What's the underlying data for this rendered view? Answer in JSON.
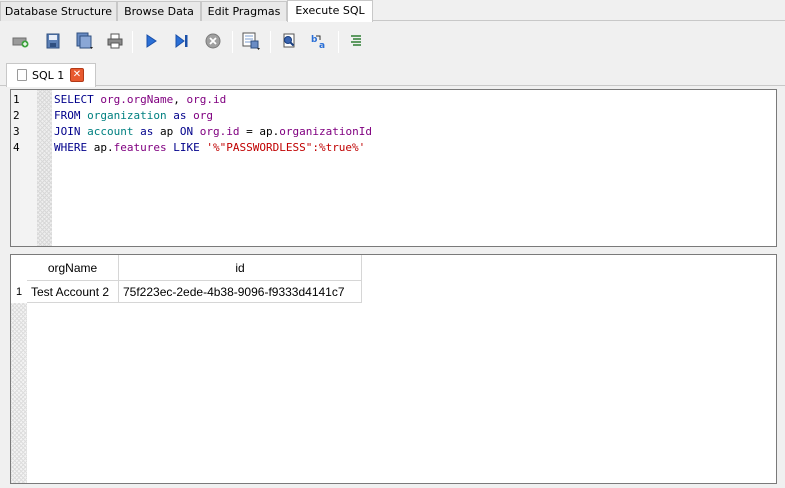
{
  "main_tabs": [
    "Database Structure",
    "Browse Data",
    "Edit Pragmas",
    "Execute SQL"
  ],
  "active_main_tab": "Execute SQL",
  "toolbar": {
    "icons": [
      "open-tab-icon",
      "open-sql-file-icon",
      "save-sql-file-icon",
      "print-icon",
      "execute-all-icon",
      "execute-current-line-icon",
      "stop-execution-icon",
      "save-results-icon",
      "find-icon",
      "find-replace-icon",
      "comment-icon"
    ]
  },
  "sql_tab": {
    "label": "SQL 1"
  },
  "editor": {
    "line_numbers": [
      "1",
      "2",
      "3",
      "4"
    ],
    "lines": [
      [
        [
          "kw",
          "SELECT"
        ],
        [
          "op",
          " "
        ],
        [
          "id",
          "org.orgName"
        ],
        [
          "op",
          ", "
        ],
        [
          "id",
          "org.id"
        ]
      ],
      [
        [
          "kw",
          "FROM"
        ],
        [
          "op",
          " "
        ],
        [
          "tbl",
          "organization"
        ],
        [
          "op",
          " "
        ],
        [
          "kw",
          "as"
        ],
        [
          "op",
          " "
        ],
        [
          "id",
          "org"
        ]
      ],
      [
        [
          "kw",
          "JOIN"
        ],
        [
          "op",
          " "
        ],
        [
          "tbl",
          "account"
        ],
        [
          "op",
          " "
        ],
        [
          "kw",
          "as"
        ],
        [
          "op",
          " ap "
        ],
        [
          "kw",
          "ON"
        ],
        [
          "op",
          " "
        ],
        [
          "id",
          "org.id"
        ],
        [
          "op",
          " = ap."
        ],
        [
          "id",
          "organizationId"
        ]
      ],
      [
        [
          "kw",
          "WHERE"
        ],
        [
          "op",
          " ap."
        ],
        [
          "id",
          "features"
        ],
        [
          "op",
          " "
        ],
        [
          "kw",
          "LIKE"
        ],
        [
          "op",
          " "
        ],
        [
          "str",
          "'%\"PASSWORDLESS\":%true%'"
        ]
      ]
    ]
  },
  "results": {
    "columns": [
      "orgName",
      "id"
    ],
    "rows": [
      {
        "num": "1",
        "cells": [
          "Test Account 2",
          "75f223ec-2ede-4b38-9096-f9333d4141c7"
        ]
      }
    ]
  }
}
